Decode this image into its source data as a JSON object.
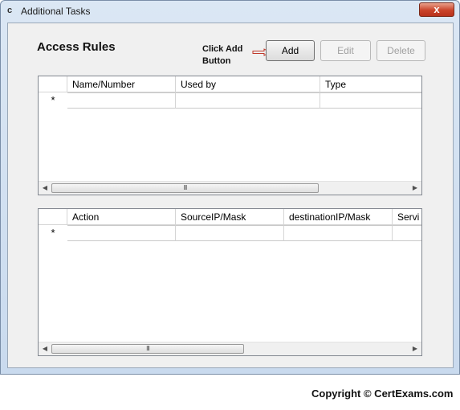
{
  "window": {
    "icon_glyph": "c",
    "title": "Additional Tasks",
    "close_glyph": "x"
  },
  "main": {
    "heading": "Access Rules",
    "hint_line1": "Click Add",
    "hint_line2": "Button",
    "hint_arrow_color": "#c0392b"
  },
  "toolbar": {
    "add_label": "Add",
    "edit_label": "Edit",
    "delete_label": "Delete",
    "edit_enabled": false,
    "delete_enabled": false
  },
  "rules_grid": {
    "columns": [
      "Name/Number",
      "Used by",
      "Type"
    ],
    "new_row_marker": "*",
    "scroll_thumb_glyph": "III"
  },
  "entries_grid": {
    "columns": [
      "Action",
      "SourceIP/Mask",
      "destinationIP/Mask",
      "Servi"
    ],
    "new_row_marker": "*",
    "scroll_thumb_glyph": "III"
  },
  "footer": {
    "copyright": "Copyright © CertExams.com"
  }
}
